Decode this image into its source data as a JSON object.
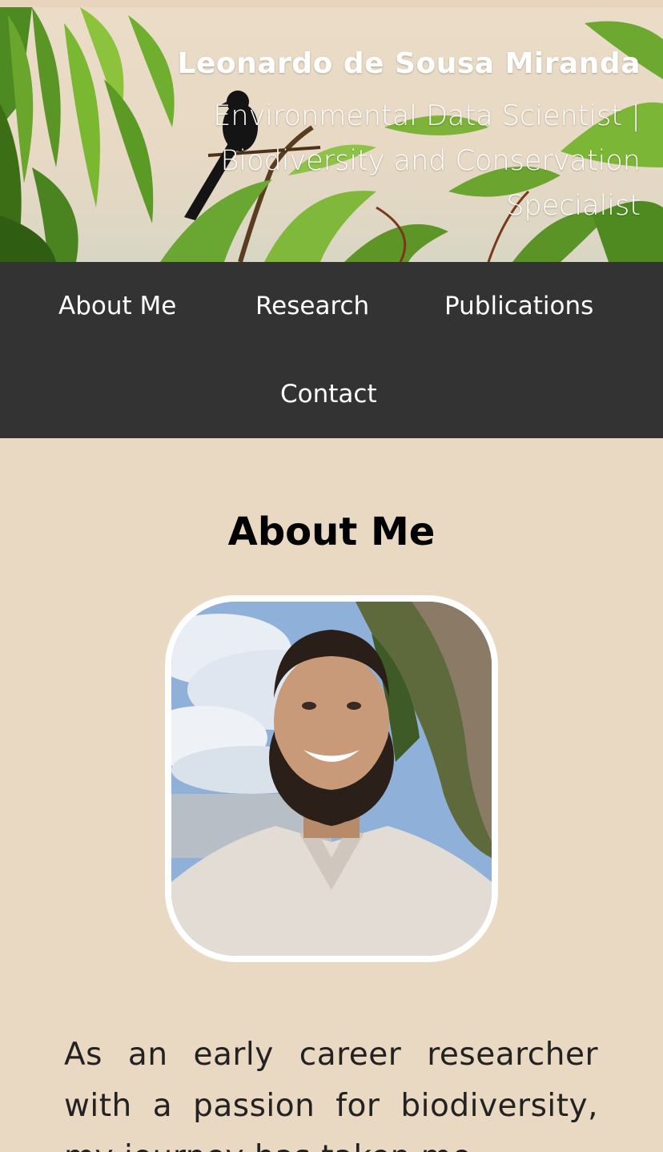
{
  "header": {
    "name": "Leonardo de Sousa Miranda",
    "role": "Environmental Data Scientist | Biodiversity and Conservation Specialist"
  },
  "nav": {
    "items": [
      {
        "label": "About Me"
      },
      {
        "label": "Research"
      },
      {
        "label": "Publications"
      },
      {
        "label": "Contact"
      }
    ]
  },
  "about": {
    "title": "About Me",
    "paragraph": "As an early career researcher with a passion for biodiversity, my journey has taken me"
  },
  "colors": {
    "page_background": "#e9d8c2",
    "nav_background": "#333333",
    "nav_text": "#ffffff",
    "heading_text": "#000000"
  }
}
